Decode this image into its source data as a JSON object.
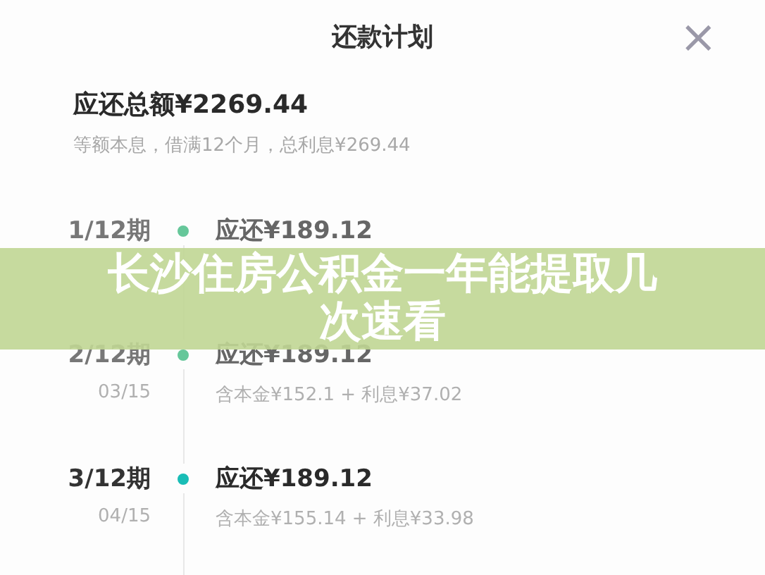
{
  "header": {
    "title": "还款计划",
    "close": "×"
  },
  "summary": {
    "total": "应还总额¥2269.44",
    "detail": "等额本息，借满12个月，总利息¥269.44"
  },
  "schedule": [
    {
      "period": "1/12期",
      "amount": "应还¥189.12",
      "current": false,
      "color": "#66c79a"
    },
    {
      "period": "2/12期",
      "amount": "应还¥189.12",
      "date": "03/15",
      "breakdown": "含本金¥152.1 + 利息¥37.02",
      "current": false,
      "color": "#66c79a"
    },
    {
      "period": "3/12期",
      "amount": "应还¥189.12",
      "date": "04/15",
      "breakdown": "含本金¥155.14 + 利息¥33.98",
      "current": true,
      "color": "#19bdb6"
    }
  ],
  "banner": {
    "title": "长沙住房公积金一年能提取几次速看"
  }
}
